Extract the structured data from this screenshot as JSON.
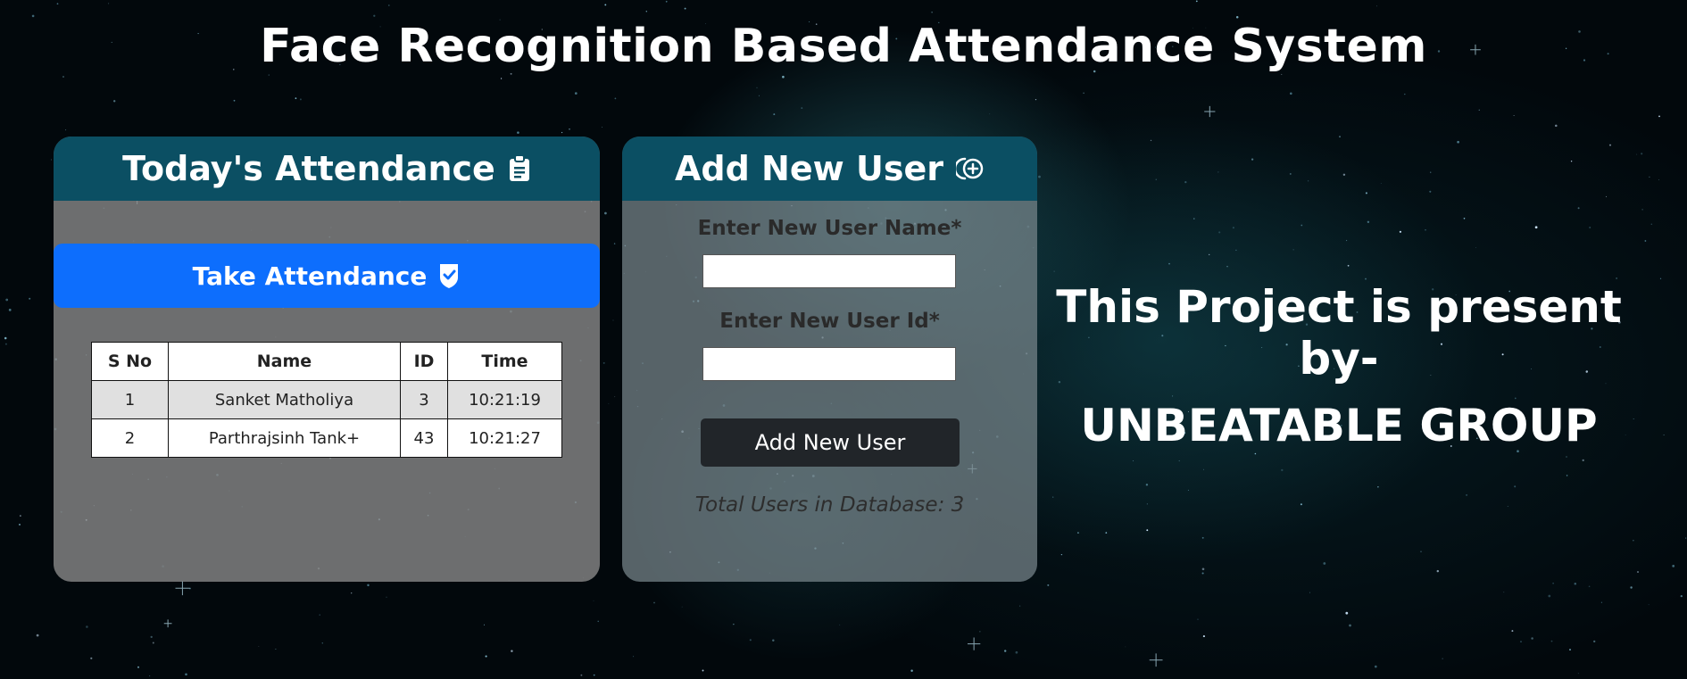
{
  "page": {
    "title": "Face Recognition Based Attendance System"
  },
  "attendance_panel": {
    "title": "Today's Attendance",
    "title_icon": "clipboard-icon",
    "take_attendance_label": "Take Attendance",
    "take_attendance_icon": "check-shield-icon",
    "table": {
      "headers": [
        "S No",
        "Name",
        "ID",
        "Time"
      ],
      "rows": [
        {
          "sno": "1",
          "name": "Sanket Matholiya",
          "id": "3",
          "time": "10:21:19"
        },
        {
          "sno": "2",
          "name": "Parthrajsinh Tank+",
          "id": "43",
          "time": "10:21:27"
        }
      ]
    }
  },
  "add_user_panel": {
    "title": "Add New User",
    "title_icon": "add-user-icon",
    "name_label": "Enter New User Name*",
    "name_value": "",
    "id_label": "Enter New User Id*",
    "id_value": "",
    "submit_label": "Add New User",
    "total_users_text": "Total Users in Database: 3"
  },
  "credits": {
    "line1": "This Project is present by-",
    "line2": "UNBEATABLE GROUP"
  },
  "colors": {
    "header_bg": "#0b4f63",
    "primary_button": "#0d6efd",
    "dark_button": "#212529"
  }
}
